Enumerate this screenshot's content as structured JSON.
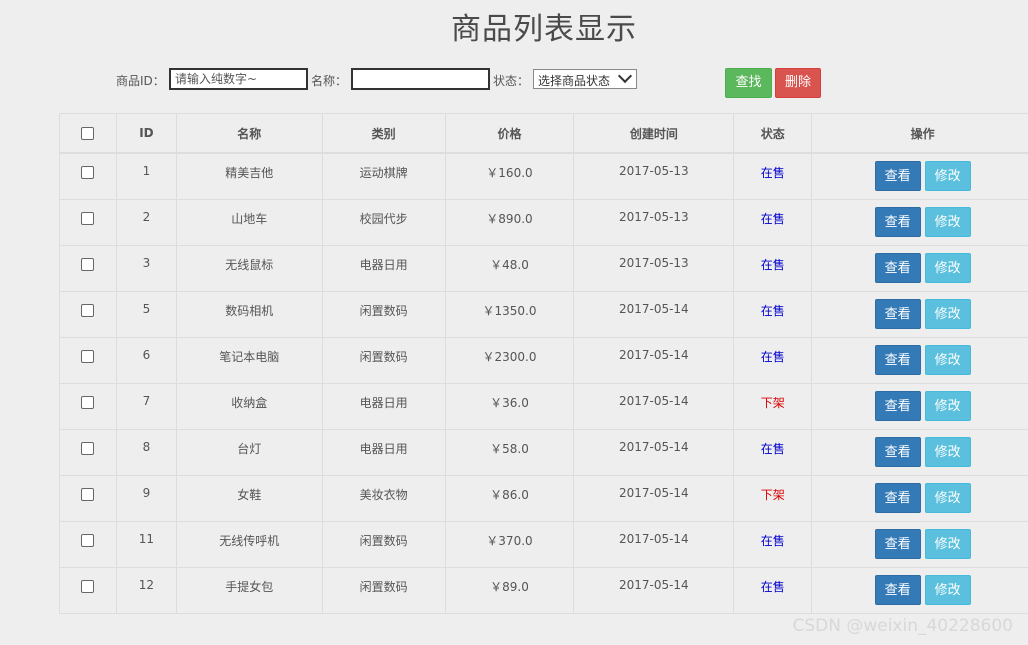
{
  "page_title": "商品列表显示",
  "filter": {
    "id_label": "商品ID：",
    "id_placeholder": "请输入纯数字~",
    "name_label": "名称：",
    "name_value": "",
    "status_label": "状态：",
    "status_selected": "选择商品状态",
    "search_label": "查找",
    "delete_label": "删除"
  },
  "table": {
    "headers": [
      "ID",
      "名称",
      "类别",
      "价格",
      "创建时间",
      "状态",
      "操作"
    ],
    "view_label": "查看",
    "edit_label": "修改",
    "rows": [
      {
        "id": "1",
        "name": "精美吉他",
        "category": "运动棋牌",
        "price": "￥160.0",
        "created": "2017-05-13",
        "status": "在售"
      },
      {
        "id": "2",
        "name": "山地车",
        "category": "校园代步",
        "price": "￥890.0",
        "created": "2017-05-13",
        "status": "在售"
      },
      {
        "id": "3",
        "name": "无线鼠标",
        "category": "电器日用",
        "price": "￥48.0",
        "created": "2017-05-13",
        "status": "在售"
      },
      {
        "id": "5",
        "name": "数码相机",
        "category": "闲置数码",
        "price": "￥1350.0",
        "created": "2017-05-14",
        "status": "在售"
      },
      {
        "id": "6",
        "name": "笔记本电脑",
        "category": "闲置数码",
        "price": "￥2300.0",
        "created": "2017-05-14",
        "status": "在售"
      },
      {
        "id": "7",
        "name": "收纳盒",
        "category": "电器日用",
        "price": "￥36.0",
        "created": "2017-05-14",
        "status": "下架"
      },
      {
        "id": "8",
        "name": "台灯",
        "category": "电器日用",
        "price": "￥58.0",
        "created": "2017-05-14",
        "status": "在售"
      },
      {
        "id": "9",
        "name": "女鞋",
        "category": "美妆衣物",
        "price": "￥86.0",
        "created": "2017-05-14",
        "status": "下架"
      },
      {
        "id": "11",
        "name": "无线传呼机",
        "category": "闲置数码",
        "price": "￥370.0",
        "created": "2017-05-14",
        "status": "在售"
      },
      {
        "id": "12",
        "name": "手提女包",
        "category": "闲置数码",
        "price": "￥89.0",
        "created": "2017-05-14",
        "status": "在售"
      }
    ]
  },
  "colors": {
    "search_button": "#5cb85c",
    "delete_button": "#d9534f",
    "view_button": "#337ab7",
    "edit_button": "#5bc0de",
    "status_on_sale": "#0000cc",
    "status_off_shelf": "#dd0000"
  },
  "watermark": "CSDN @weixin_40228600"
}
